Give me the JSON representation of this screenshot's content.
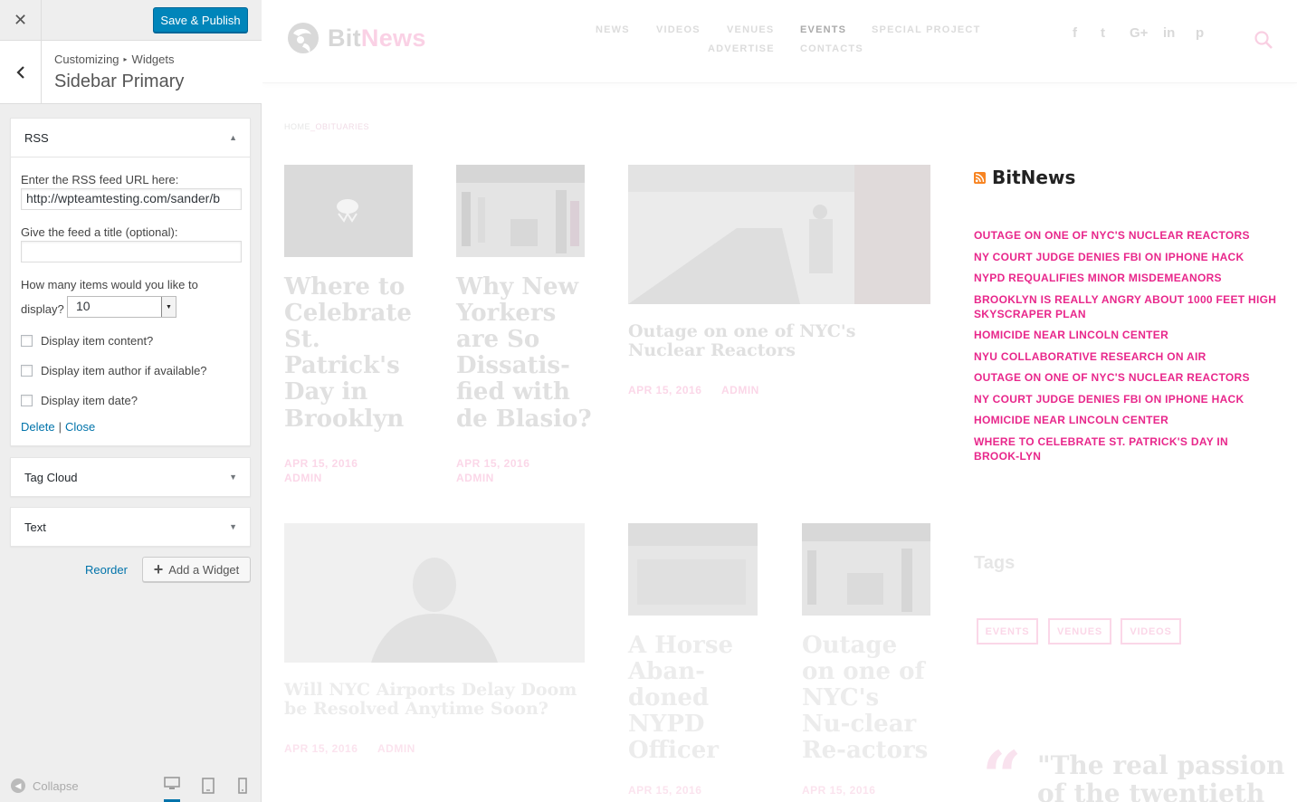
{
  "customizer": {
    "close_label": "✕",
    "save_label": "Save & Publish",
    "breadcrumb": [
      "Customizing",
      "Widgets"
    ],
    "section_title": "Sidebar Primary",
    "rss_widget": {
      "title": "RSS",
      "url_label": "Enter the RSS feed URL here:",
      "url_value": "http://wpteamtesting.com/sander/b",
      "feed_title_label": "Give the feed a title (optional):",
      "feed_title_value": "",
      "items_label_1": "How many items would you like to",
      "items_label_2": "display?",
      "items_value": "10",
      "show_content_label": "Display item content?",
      "show_author_label": "Display item author if available?",
      "show_date_label": "Display item date?",
      "delete_label": "Delete",
      "separator": "|",
      "close_label": "Close"
    },
    "tag_cloud_widget": {
      "title": "Tag Cloud"
    },
    "text_widget": {
      "title": "Text"
    },
    "reorder_label": "Reorder",
    "add_widget_label": "Add a Widget",
    "collapse_label": "Collapse"
  },
  "site": {
    "logo_bit": "Bit",
    "logo_news": "News",
    "nav": [
      "NEWS",
      "VIDEOS",
      "VENUES",
      "EVENTS",
      "SPECIAL PROJECT",
      "ADVERTISE",
      "CONTACTS"
    ],
    "social": [
      "f",
      "t",
      "G+",
      "in",
      "p"
    ],
    "breadcrumb_home": "HOME",
    "breadcrumb_sep": "_",
    "breadcrumb_current": "OBITUARIES",
    "posts": [
      {
        "title": "Where to Celebrate St. Patrick's Day in Brooklyn",
        "date": "APR 15, 2016",
        "author": "ADMIN"
      },
      {
        "title": "Why New Yorkers are So Dissatis-fied with de Blasio?",
        "date": "APR 15, 2016",
        "author": "ADMIN"
      },
      {
        "title": "Outage on one of NYC's Nuclear Reactors",
        "date": "APR 15, 2016",
        "author": "ADMIN"
      },
      {
        "title": "Will NYC Airports Delay Doom be Resolved Anytime Soon?",
        "date": "APR 15, 2016",
        "author": "ADMIN"
      },
      {
        "title": "A Horse Aban-doned NYPD Officer",
        "date": "APR 15, 2016",
        "author": ""
      },
      {
        "title": "Outage on one of NYC's Nu-clear Re-actors",
        "date": "APR 15, 2016",
        "author": ""
      }
    ],
    "rss_title": "BitNews",
    "rss_items": [
      "OUTAGE ON ONE OF NYC'S NUCLEAR REACTORS",
      "NY COURT JUDGE DENIES FBI ON IPHONE HACK",
      "NYPD REQUALIFIES MINOR MISDEMEANORS",
      "BROOKLYN IS REALLY ANGRY ABOUT 1000 FEET HIGH SKYSCRAPER PLAN",
      "HOMICIDE NEAR LINCOLN CENTER",
      "NYU COLLABORATIVE RESEARCH ON AIR",
      "OUTAGE ON ONE OF NYC'S NUCLEAR REACTORS",
      "NY COURT JUDGE DENIES FBI ON IPHONE HACK",
      "HOMICIDE NEAR LINCOLN CENTER",
      "WHERE TO CELEBRATE ST. PATRICK'S DAY IN BROOK-LYN"
    ],
    "tags_title": "Tags",
    "tags": [
      "EVENTS",
      "VENUES",
      "VIDEOS"
    ],
    "quote_mark": "“",
    "quote_text": "\"The real passion of the twentieth"
  },
  "colors": {
    "accent_blue": "#0085ba",
    "brand_pink": "#e8278b",
    "rss_orange": "#f78422"
  }
}
